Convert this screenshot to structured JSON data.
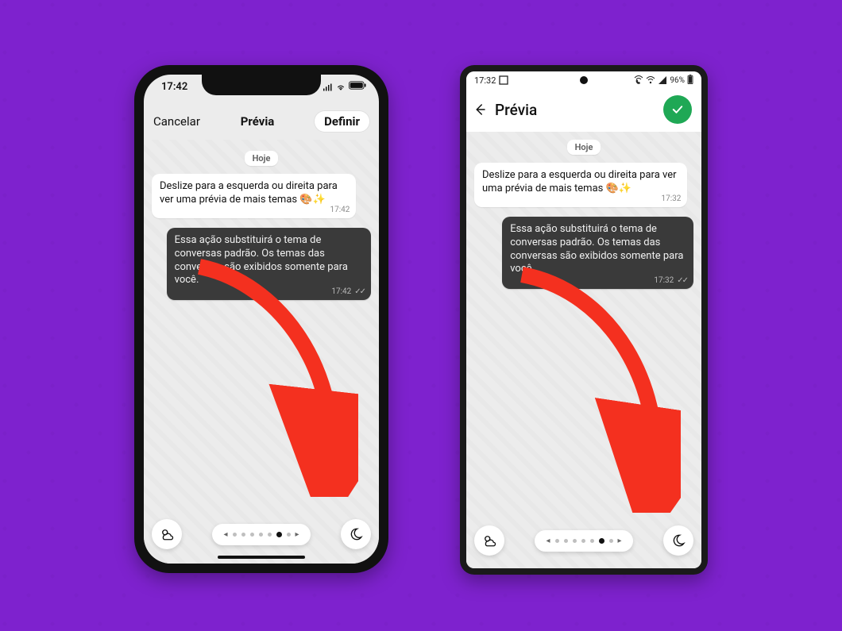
{
  "iphone": {
    "status_time": "17:42",
    "cancel": "Cancelar",
    "title": "Prévia",
    "define": "Definir",
    "date_chip": "Hoje",
    "msg_in": "Deslize para a esquerda ou direita para ver uma prévia de mais temas 🎨✨",
    "msg_in_time": "17:42",
    "msg_out": "Essa ação substituirá o tema de conversas padrão. Os temas das conversas são exibidos somente para você.",
    "msg_out_time": "17:42"
  },
  "android": {
    "status_time": "17:32",
    "battery": "96%",
    "title": "Prévia",
    "date_chip": "Hoje",
    "msg_in": "Deslize para a esquerda ou direita para ver uma prévia de mais temas 🎨✨",
    "msg_in_time": "17:32",
    "msg_out": "Essa ação substituirá o tema de conversas padrão. Os temas das conversas são exibidos somente para você.",
    "msg_out_time": "17:32"
  }
}
